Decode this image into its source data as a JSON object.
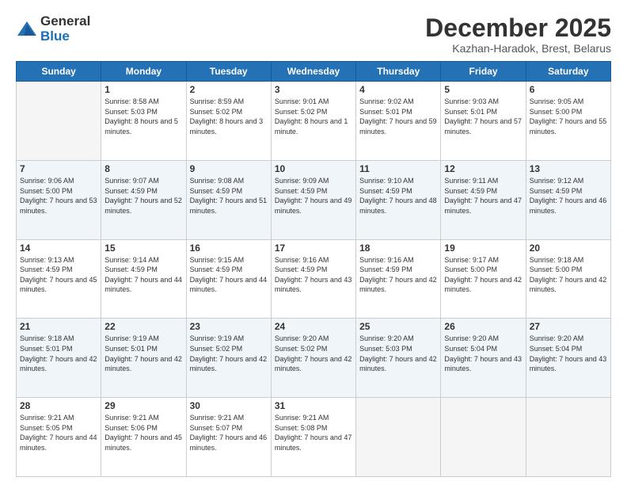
{
  "logo": {
    "general": "General",
    "blue": "Blue"
  },
  "header": {
    "month": "December 2025",
    "location": "Kazhan-Haradok, Brest, Belarus"
  },
  "days_header": [
    "Sunday",
    "Monday",
    "Tuesday",
    "Wednesday",
    "Thursday",
    "Friday",
    "Saturday"
  ],
  "weeks": [
    [
      {
        "day": "",
        "empty": true
      },
      {
        "day": "1",
        "sunrise": "8:58 AM",
        "sunset": "5:03 PM",
        "daylight": "8 hours and 5 minutes."
      },
      {
        "day": "2",
        "sunrise": "8:59 AM",
        "sunset": "5:02 PM",
        "daylight": "8 hours and 3 minutes."
      },
      {
        "day": "3",
        "sunrise": "9:01 AM",
        "sunset": "5:02 PM",
        "daylight": "8 hours and 1 minute."
      },
      {
        "day": "4",
        "sunrise": "9:02 AM",
        "sunset": "5:01 PM",
        "daylight": "7 hours and 59 minutes."
      },
      {
        "day": "5",
        "sunrise": "9:03 AM",
        "sunset": "5:01 PM",
        "daylight": "7 hours and 57 minutes."
      },
      {
        "day": "6",
        "sunrise": "9:05 AM",
        "sunset": "5:00 PM",
        "daylight": "7 hours and 55 minutes."
      }
    ],
    [
      {
        "day": "7",
        "sunrise": "9:06 AM",
        "sunset": "5:00 PM",
        "daylight": "7 hours and 53 minutes."
      },
      {
        "day": "8",
        "sunrise": "9:07 AM",
        "sunset": "4:59 PM",
        "daylight": "7 hours and 52 minutes."
      },
      {
        "day": "9",
        "sunrise": "9:08 AM",
        "sunset": "4:59 PM",
        "daylight": "7 hours and 51 minutes."
      },
      {
        "day": "10",
        "sunrise": "9:09 AM",
        "sunset": "4:59 PM",
        "daylight": "7 hours and 49 minutes."
      },
      {
        "day": "11",
        "sunrise": "9:10 AM",
        "sunset": "4:59 PM",
        "daylight": "7 hours and 48 minutes."
      },
      {
        "day": "12",
        "sunrise": "9:11 AM",
        "sunset": "4:59 PM",
        "daylight": "7 hours and 47 minutes."
      },
      {
        "day": "13",
        "sunrise": "9:12 AM",
        "sunset": "4:59 PM",
        "daylight": "7 hours and 46 minutes."
      }
    ],
    [
      {
        "day": "14",
        "sunrise": "9:13 AM",
        "sunset": "4:59 PM",
        "daylight": "7 hours and 45 minutes."
      },
      {
        "day": "15",
        "sunrise": "9:14 AM",
        "sunset": "4:59 PM",
        "daylight": "7 hours and 44 minutes."
      },
      {
        "day": "16",
        "sunrise": "9:15 AM",
        "sunset": "4:59 PM",
        "daylight": "7 hours and 44 minutes."
      },
      {
        "day": "17",
        "sunrise": "9:16 AM",
        "sunset": "4:59 PM",
        "daylight": "7 hours and 43 minutes."
      },
      {
        "day": "18",
        "sunrise": "9:16 AM",
        "sunset": "4:59 PM",
        "daylight": "7 hours and 42 minutes."
      },
      {
        "day": "19",
        "sunrise": "9:17 AM",
        "sunset": "5:00 PM",
        "daylight": "7 hours and 42 minutes."
      },
      {
        "day": "20",
        "sunrise": "9:18 AM",
        "sunset": "5:00 PM",
        "daylight": "7 hours and 42 minutes."
      }
    ],
    [
      {
        "day": "21",
        "sunrise": "9:18 AM",
        "sunset": "5:01 PM",
        "daylight": "7 hours and 42 minutes."
      },
      {
        "day": "22",
        "sunrise": "9:19 AM",
        "sunset": "5:01 PM",
        "daylight": "7 hours and 42 minutes."
      },
      {
        "day": "23",
        "sunrise": "9:19 AM",
        "sunset": "5:02 PM",
        "daylight": "7 hours and 42 minutes."
      },
      {
        "day": "24",
        "sunrise": "9:20 AM",
        "sunset": "5:02 PM",
        "daylight": "7 hours and 42 minutes."
      },
      {
        "day": "25",
        "sunrise": "9:20 AM",
        "sunset": "5:03 PM",
        "daylight": "7 hours and 42 minutes."
      },
      {
        "day": "26",
        "sunrise": "9:20 AM",
        "sunset": "5:04 PM",
        "daylight": "7 hours and 43 minutes."
      },
      {
        "day": "27",
        "sunrise": "9:20 AM",
        "sunset": "5:04 PM",
        "daylight": "7 hours and 43 minutes."
      }
    ],
    [
      {
        "day": "28",
        "sunrise": "9:21 AM",
        "sunset": "5:05 PM",
        "daylight": "7 hours and 44 minutes."
      },
      {
        "day": "29",
        "sunrise": "9:21 AM",
        "sunset": "5:06 PM",
        "daylight": "7 hours and 45 minutes."
      },
      {
        "day": "30",
        "sunrise": "9:21 AM",
        "sunset": "5:07 PM",
        "daylight": "7 hours and 46 minutes."
      },
      {
        "day": "31",
        "sunrise": "9:21 AM",
        "sunset": "5:08 PM",
        "daylight": "7 hours and 47 minutes."
      },
      {
        "day": "",
        "empty": true
      },
      {
        "day": "",
        "empty": true
      },
      {
        "day": "",
        "empty": true
      }
    ]
  ]
}
